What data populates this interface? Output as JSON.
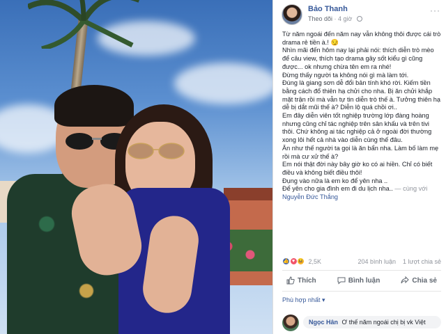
{
  "post": {
    "author": "Bảo Thanh",
    "follow_label": "Theo dõi",
    "time": "4 giờ",
    "paragraphs": [
      "Từ năm ngoái đến năm nay vẫn không thôi được cái trò drama rẻ tiền à.! 😏",
      "Nhìn mãi đến hôm nay lại phải nói: thích diễn trò mèo để câu view, thích tạo drama gây sốt kiểu gì cũng được... ok nhưng chừa tên em ra nhé!",
      "Đừng thấy người ta không nói gì mà làm tới.",
      "Đúng là giang sơn dễ đổi bản tính khó rời. Kiếm tiền bằng cách đổ thiên hạ chửi cho nha. Bị ăn chửi khắp mặt trận rồi mà vẫn tự tin diễn trò thế à. Tưởng thiên hạ dễ bị dắt mũi thế à? Diễn lộ quá chồi ơi..",
      "Em đây diễn viên tốt nghiệp trường lớp đàng hoàng nhưng cũng chỉ tác nghiệp trên sân khấu và trên tivi thôi. Chứ không ai tác nghiệp cả ở ngoài đời thường xong lôi hết cả nhà vào diễn cùng thế đâu.",
      "Ăn như thế người ta gọi là ăn bẩn nha. Làm bố làm mẹ rồi mà cư xử thế à?",
      "Em nói thật đời này bây giờ ko có ai hiền. Chỉ có biết điều và không biết điều thôi!",
      "Đụng vào nữa là em ko để yên nha .."
    ],
    "last_line": "Để yên cho gia đình em đi du lịch nha..",
    "with_text": "— cùng với",
    "tagged": "Nguyễn Đức Thắng"
  },
  "reactions": {
    "count": "2,5K",
    "comments": "204 bình luận",
    "shares": "1 lượt chia sẻ"
  },
  "actions": {
    "like": "Thích",
    "comment": "Bình luận",
    "share": "Chia sẻ"
  },
  "relevant_label": "Phù hợp nhất",
  "first_comment": {
    "name": "Ngọc Hân",
    "text": "Ơ thế năm ngoái chị bị vk Việt"
  },
  "colors": {
    "link": "#365899",
    "muted": "#90949c",
    "like": "#4267b2",
    "love": "#f25268",
    "haha": "#f7b125"
  }
}
